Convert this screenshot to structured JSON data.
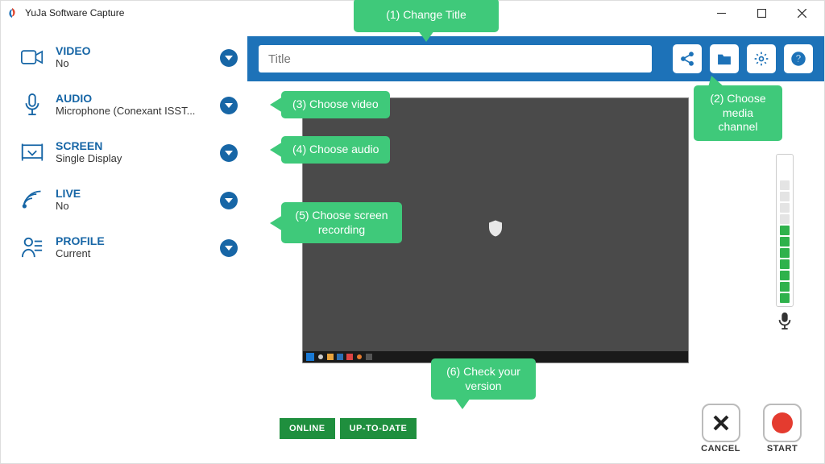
{
  "window": {
    "title": "YuJa Software Capture"
  },
  "sidebar": {
    "video": {
      "label": "VIDEO",
      "value": "No"
    },
    "audio": {
      "label": "AUDIO",
      "value": "Microphone (Conexant ISST..."
    },
    "screen": {
      "label": "SCREEN",
      "value": "Single Display"
    },
    "live": {
      "label": "LIVE",
      "value": "No"
    },
    "profile": {
      "label": "PROFILE",
      "value": "Current"
    }
  },
  "topbar": {
    "title_placeholder": "Title"
  },
  "status": {
    "online": "ONLINE",
    "uptodate": "UP-TO-DATE"
  },
  "buttons": {
    "cancel": "CANCEL",
    "start": "START"
  },
  "audio_meter": {
    "segments": 11,
    "active": 7
  },
  "annotations": {
    "a1": "(1) Change Title",
    "a2": "(2) Choose media channel",
    "a3": "(3) Choose video",
    "a4": "(4) Choose audio",
    "a5": "(5) Choose screen recording",
    "a6": "(6) Check your version"
  }
}
